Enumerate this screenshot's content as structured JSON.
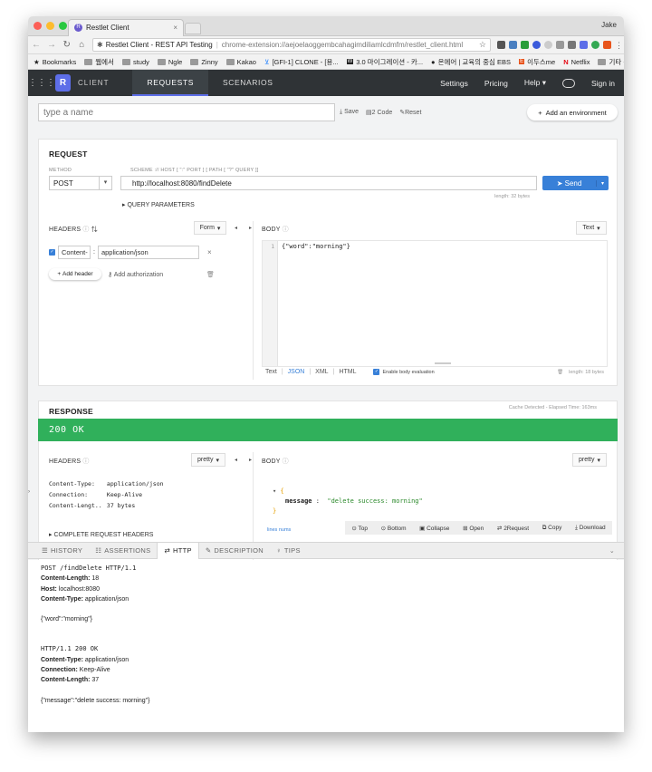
{
  "browser": {
    "tab_title": "Restlet Client",
    "user": "Jake",
    "app_name": "Restlet Client - REST API Testing",
    "url": "chrome-extension://aejoelaoggembcahagimdiliamlcdmfm/restlet_client.html",
    "bookmarks": [
      "Bookmarks",
      "Ngle",
      "Zinny",
      "Kakao",
      "[GFI-1] CLONE - [용...",
      "3.0 마이그레이션 - 카...",
      "Netflix"
    ],
    "bookmarks_ko": [
      "웹에서",
      "study",
      "온에어 | 교육의 중심 EBS",
      "이두스me",
      "기타 북마크"
    ]
  },
  "appnav": {
    "logo_letter": "R",
    "logo_text": "CLIENT",
    "tabs": [
      "REQUESTS",
      "SCENARIOS"
    ],
    "right": [
      "Settings",
      "Pricing",
      "Help",
      "Sign in"
    ]
  },
  "toolbar": {
    "name_placeholder": "type a name",
    "save": "Save",
    "code": "2 Code",
    "reset": "Reset",
    "add_env": "Add an environment"
  },
  "request": {
    "title": "REQUEST",
    "method_label": "METHOD",
    "method": "POST",
    "scheme_label": "SCHEME :// HOST [ \":\" PORT ] [ PATH [ \"?\" QUERY ]]",
    "url": "http://localhost:8080/findDelete",
    "send": "Send",
    "length": "length: 32 bytes",
    "query_params": "QUERY PARAMETERS",
    "headers_label": "HEADERS",
    "form": "Form",
    "header_key": "Content-",
    "header_value": "application/json",
    "add_header": "Add header",
    "add_auth": "Add authorization",
    "body_label": "BODY",
    "body_type": "Text",
    "body_line_no": "1",
    "body_code": "{\"word\":\"morning\"}",
    "formats": [
      "Text",
      "JSON",
      "XML",
      "HTML"
    ],
    "enable_eval": "Enable body evaluation",
    "body_length": "length: 18 bytes"
  },
  "response": {
    "title": "RESPONSE",
    "cache_note": "Cache Detected - Elapsed Time: 163ms",
    "status": "200 OK",
    "headers_label": "HEADERS",
    "pretty": "pretty",
    "body_label": "BODY",
    "headers": [
      {
        "k": "Content-Type:",
        "v": "application/json"
      },
      {
        "k": "Connection:",
        "v": "Keep-Alive"
      },
      {
        "k": "Content-Lengt...",
        "v": "37 bytes"
      }
    ],
    "complete_headers": "COMPLETE REQUEST HEADERS",
    "json_key": "message",
    "json_value": "\"delete success: morning\"",
    "lines_nums": "lines nums",
    "actions": [
      "Top",
      "Bottom",
      "Collapse",
      "Open",
      "2Request",
      "Copy",
      "Download"
    ]
  },
  "bottom": {
    "tabs": [
      "HISTORY",
      "ASSERTIONS",
      "HTTP",
      "DESCRIPTION",
      "TIPS"
    ],
    "req_line": "POST /findDelete HTTP/1.1",
    "req_headers": [
      {
        "k": "Content-Length:",
        "v": "18"
      },
      {
        "k": "Host:",
        "v": "localhost:8080"
      },
      {
        "k": "Content-Type:",
        "v": "application/json"
      }
    ],
    "req_body": "{\"word\":\"morning\"}",
    "resp_line": "HTTP/1.1 200 OK",
    "resp_headers": [
      {
        "k": "Content-Type:",
        "v": "application/json"
      },
      {
        "k": "Connection:",
        "v": "Keep-Alive"
      },
      {
        "k": "Content-Length:",
        "v": "37"
      }
    ],
    "resp_body": "{\"message\":\"delete success: morning\"}"
  },
  "colors": {
    "nav_bg": "#2f3336",
    "accent": "#3880d8",
    "status_ok": "#30b05b",
    "logo": "#5d6ee8"
  }
}
